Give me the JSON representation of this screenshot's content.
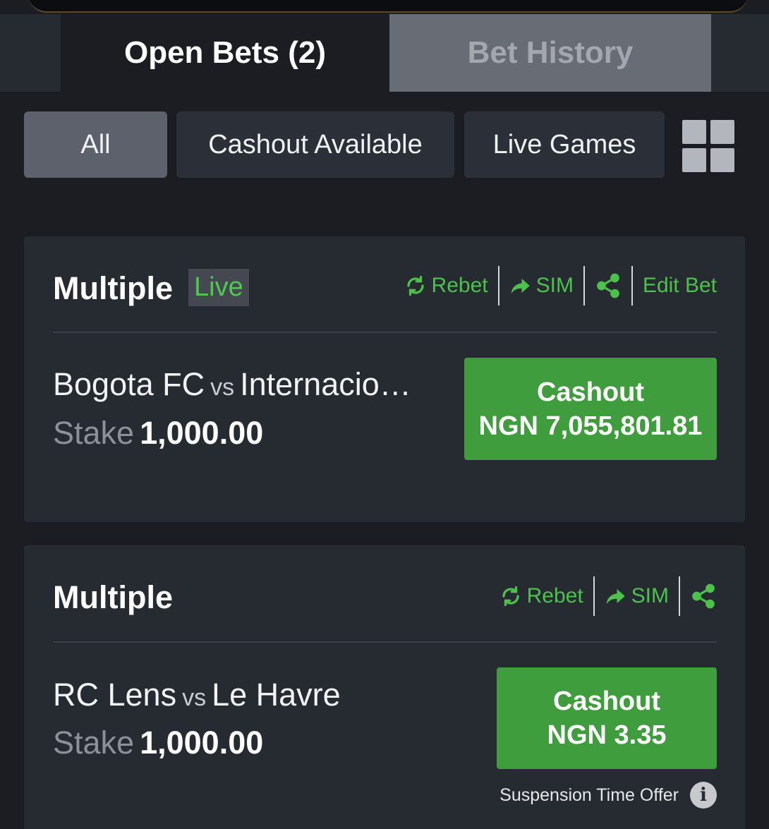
{
  "tabs": {
    "open_bets": "Open Bets (2)",
    "bet_history": "Bet History"
  },
  "filters": {
    "all": "All",
    "cashout_available": "Cashout Available",
    "live_games": "Live Games",
    "layout_icon": "grid-icon"
  },
  "actions": {
    "rebet": "Rebet",
    "sim": "SIM",
    "edit_bet": "Edit Bet"
  },
  "bets": [
    {
      "type": "Multiple",
      "badge": "Live",
      "home": "Bogota FC",
      "vs": "vs",
      "away": "Internacio…",
      "stake_label": "Stake",
      "stake": "1,000.00",
      "cashout_label": "Cashout",
      "cashout_amount": "NGN 7,055,801.81"
    },
    {
      "type": "Multiple",
      "home": "RC Lens",
      "vs": "vs",
      "away": "Le Havre",
      "stake_label": "Stake",
      "stake": "1,000.00",
      "cashout_label": "Cashout",
      "cashout_amount": "NGN 3.35",
      "note": "Suspension Time Offer"
    }
  ],
  "colors": {
    "accent_green": "#4cc24c",
    "cashout_green": "#3f9d3d",
    "background": "#1b1d22",
    "card": "#262a31"
  }
}
